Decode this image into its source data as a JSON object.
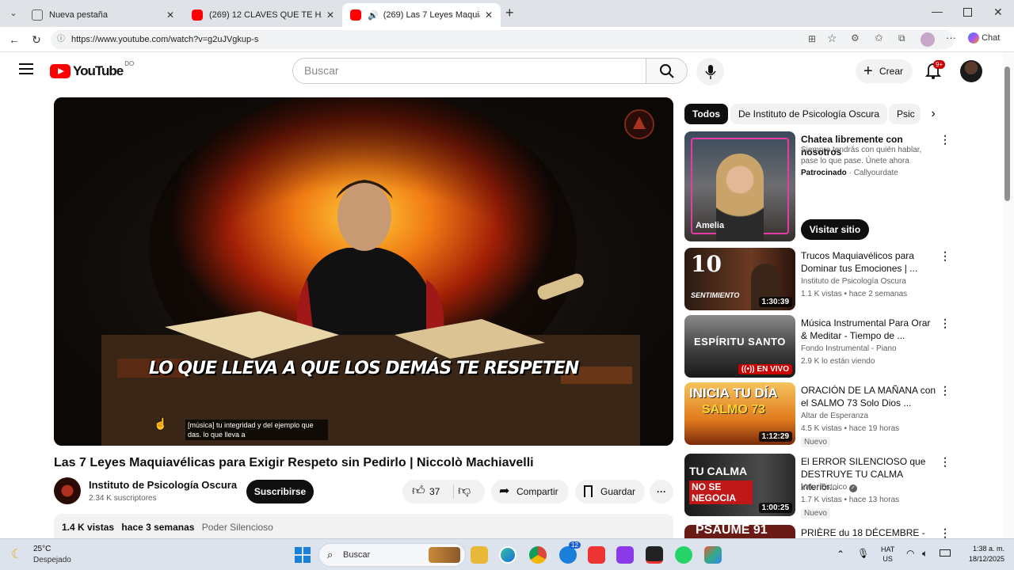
{
  "browser": {
    "tabs": [
      {
        "label": "Nueva pestaña"
      },
      {
        "label": "(269) 12 CLAVES QUE TE HARÁN S"
      },
      {
        "label": "(269) Las 7 Leyes Maquiavélic"
      }
    ],
    "url": "https://www.youtube.com/watch?v=g2uJVgkup-s",
    "chat_label": "Chat"
  },
  "header": {
    "logo_text": "YouTube",
    "country": "DO",
    "search_placeholder": "Buscar",
    "create_label": "Crear",
    "notif_count": "9+"
  },
  "video": {
    "overlay_text": "LO QUE LLEVA A QUE LOS DEMÁS TE RESPETEN",
    "subtitle_line1": "[música] tu integridad y del ejemplo que",
    "subtitle_line2": "das. lo que lleva a",
    "title": "Las 7 Leyes Maquiavélicas para Exigir Respeto sin Pedirlo | Niccolò Machiavelli",
    "channel": "Instituto de Psicología Oscura",
    "subscribers": "2.34 K suscriptores",
    "subscribe_label": "Suscribirse",
    "likes": "37",
    "share_label": "Compartir",
    "save_label": "Guardar",
    "views": "1.4 K vistas",
    "time": "hace 3 semanas",
    "tag": "Poder Silencioso"
  },
  "chips": [
    {
      "label": "Todos"
    },
    {
      "label": "De Instituto de Psicología Oscura"
    },
    {
      "label": "Psic"
    }
  ],
  "recommendations": [
    {
      "title": "Chatea libremente con nosotros",
      "line2": "Siempre tendrás con quién hablar, pase lo que pase. Únete ahora",
      "sponsored": "Patrocinado",
      "advertiser": "Callyourdate",
      "cta": "Visitar sitio",
      "thumb_name": "Amelia"
    },
    {
      "title": "Trucos Maquiavélicos para Dominar tus Emociones | ...",
      "channel": "Instituto de Psicología Oscura",
      "meta": "1.1 K vistas • hace 2 semanas",
      "duration": "1:30:39",
      "thumb_text": "10",
      "thumb_sub": "SENTIMIENTO"
    },
    {
      "title": "Música Instrumental Para Orar & Meditar - Tiempo de ...",
      "channel": "Fondo Instrumental - Piano",
      "meta": "2.9 K lo están viendo",
      "live": "EN VIVO",
      "thumb_text": "ESPÍRITU SANTO"
    },
    {
      "title": "ORACIÓN DE LA MAÑANA con el SALMO 73  Solo Dios ...",
      "channel": "Altar de Esperanza",
      "meta": "4.5 K vistas • hace 19 horas",
      "duration": "1:12:29",
      "badge": "Nuevo",
      "thumb_text": "INICIA TU DÍA",
      "thumb_sub": "SALMO 73"
    },
    {
      "title": "El ERROR SILENCIOSO que DESTRUYE TU CALMA interior...",
      "channel": "Valor Estoico",
      "meta": "1.7 K vistas • hace 13 horas",
      "duration": "1:00:25",
      "badge": "Nuevo",
      "thumb_text": "TU CALMA",
      "thumb_sub": "NO SE NEGOCIA"
    },
    {
      "title": "PRIÈRE du 18 DÉCEMBRE -",
      "thumb_text": "PSAUME 91"
    }
  ],
  "taskbar": {
    "temp": "25°C",
    "weather": "Despejado",
    "search_label": "Buscar",
    "lang1": "HAT",
    "lang2": "US",
    "time": "1:38 a. m.",
    "date": "18/12/2025",
    "edge_badge": "12"
  }
}
